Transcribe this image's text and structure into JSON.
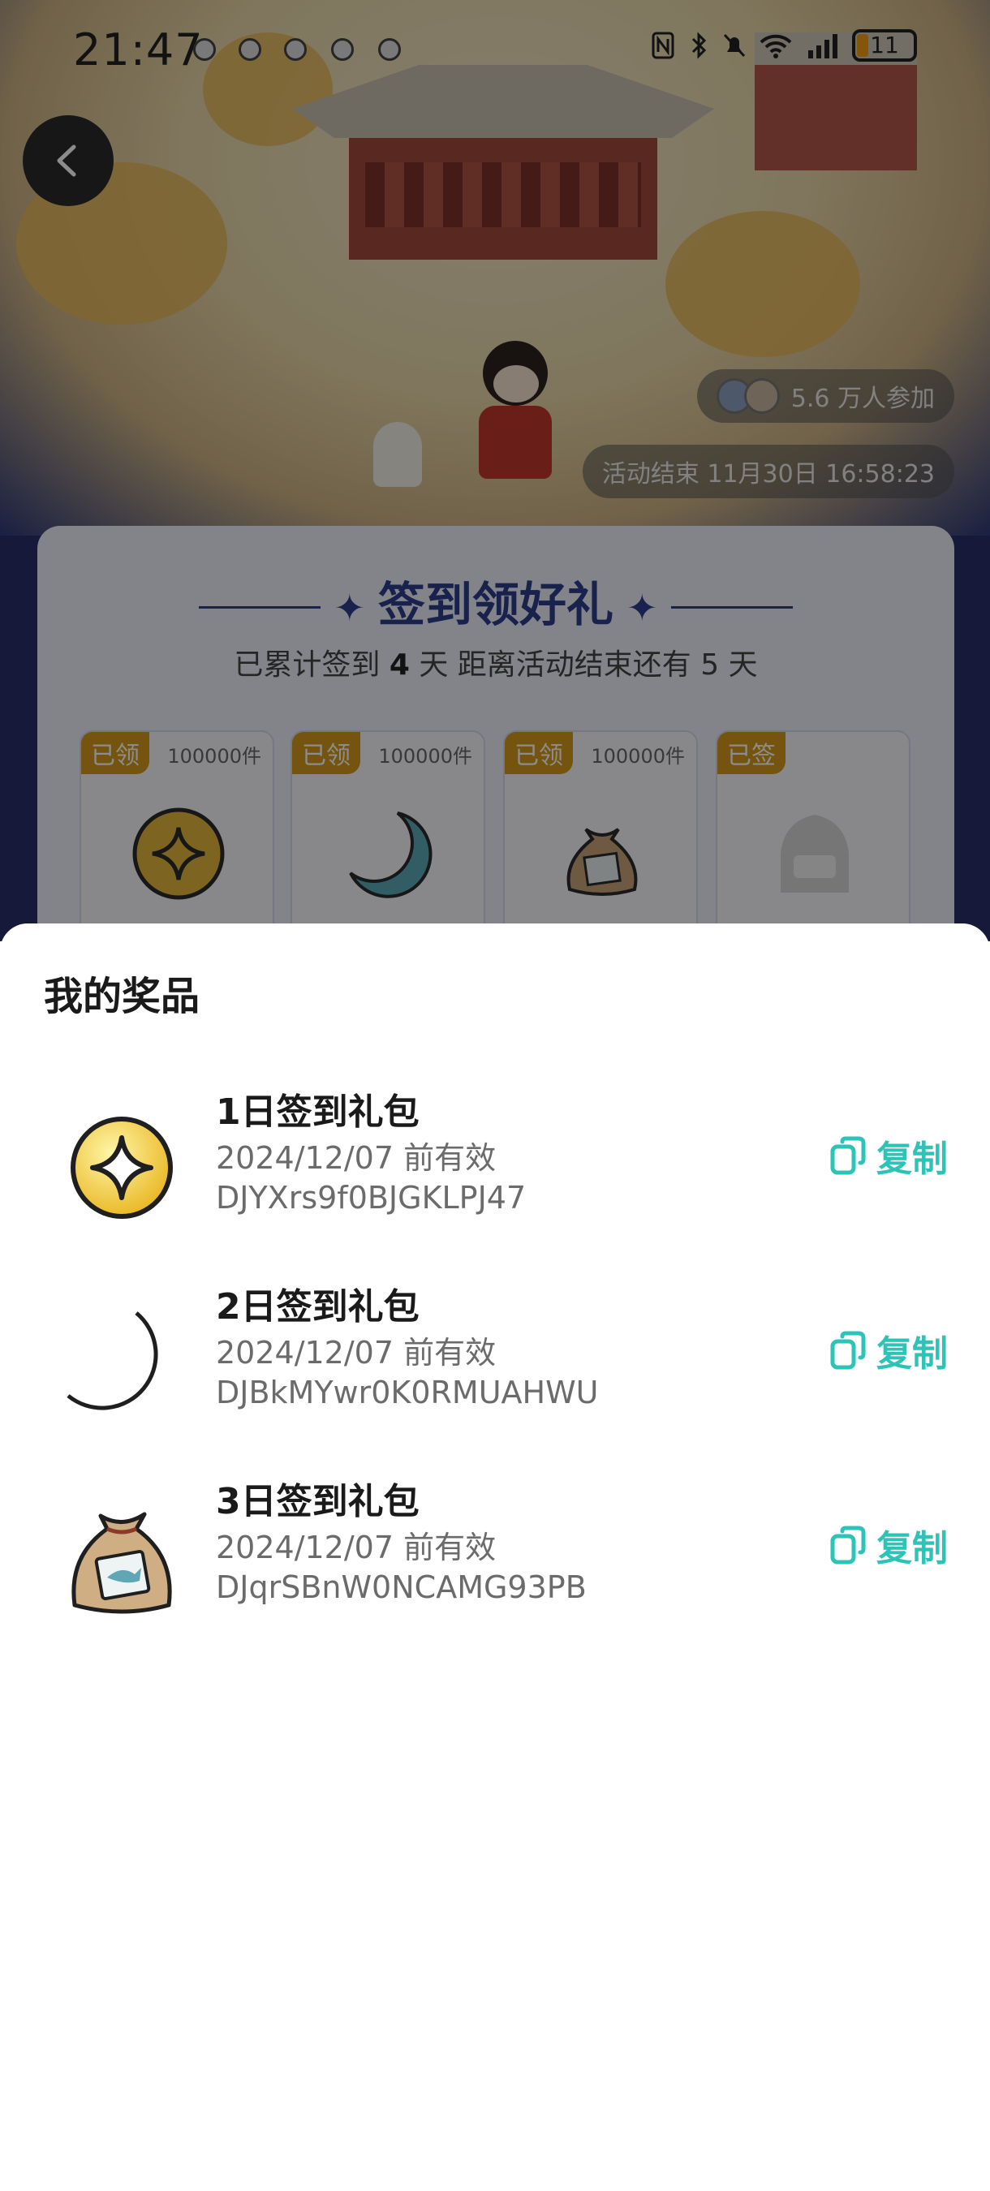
{
  "status_bar": {
    "time": "21:47",
    "battery": "11"
  },
  "hero": {
    "participants": "5.6 万人参加",
    "end_time": "活动结束 11月30日 16:58:23"
  },
  "signin_card": {
    "title": "签到领好礼",
    "subtitle_prefix": "已累计签到",
    "days_signed": "4",
    "subtitle_mid": "天  距离活动结束还有",
    "days_left": "5",
    "subtitle_suffix": "天",
    "rewards": [
      {
        "tag": "已领",
        "qty": "100000件",
        "icon": "coin-icon"
      },
      {
        "tag": "已领",
        "qty": "100000件",
        "icon": "moon-icon"
      },
      {
        "tag": "已领",
        "qty": "100000件",
        "icon": "bag-icon"
      },
      {
        "tag": "已签",
        "qty": "",
        "icon": "mystery-icon"
      }
    ]
  },
  "prizes_sheet": {
    "title": "我的奖品",
    "copy_label": "复制",
    "items": [
      {
        "name": "1日签到礼包",
        "expire": "2024/12/07 前有效",
        "code": "DJYXrs9f0BJGKLPJ47",
        "icon": "coin-icon"
      },
      {
        "name": "2日签到礼包",
        "expire": "2024/12/07 前有效",
        "code": "DJBkMYwr0K0RMUAHWU",
        "icon": "moon-icon"
      },
      {
        "name": "3日签到礼包",
        "expire": "2024/12/07 前有效",
        "code": "DJqrSBnW0NCAMG93PB",
        "icon": "bag-icon"
      }
    ]
  },
  "colors": {
    "accent": "#2bc4b6",
    "title_blue": "#2f3d8d",
    "tag_gold": "#d39a1a"
  }
}
